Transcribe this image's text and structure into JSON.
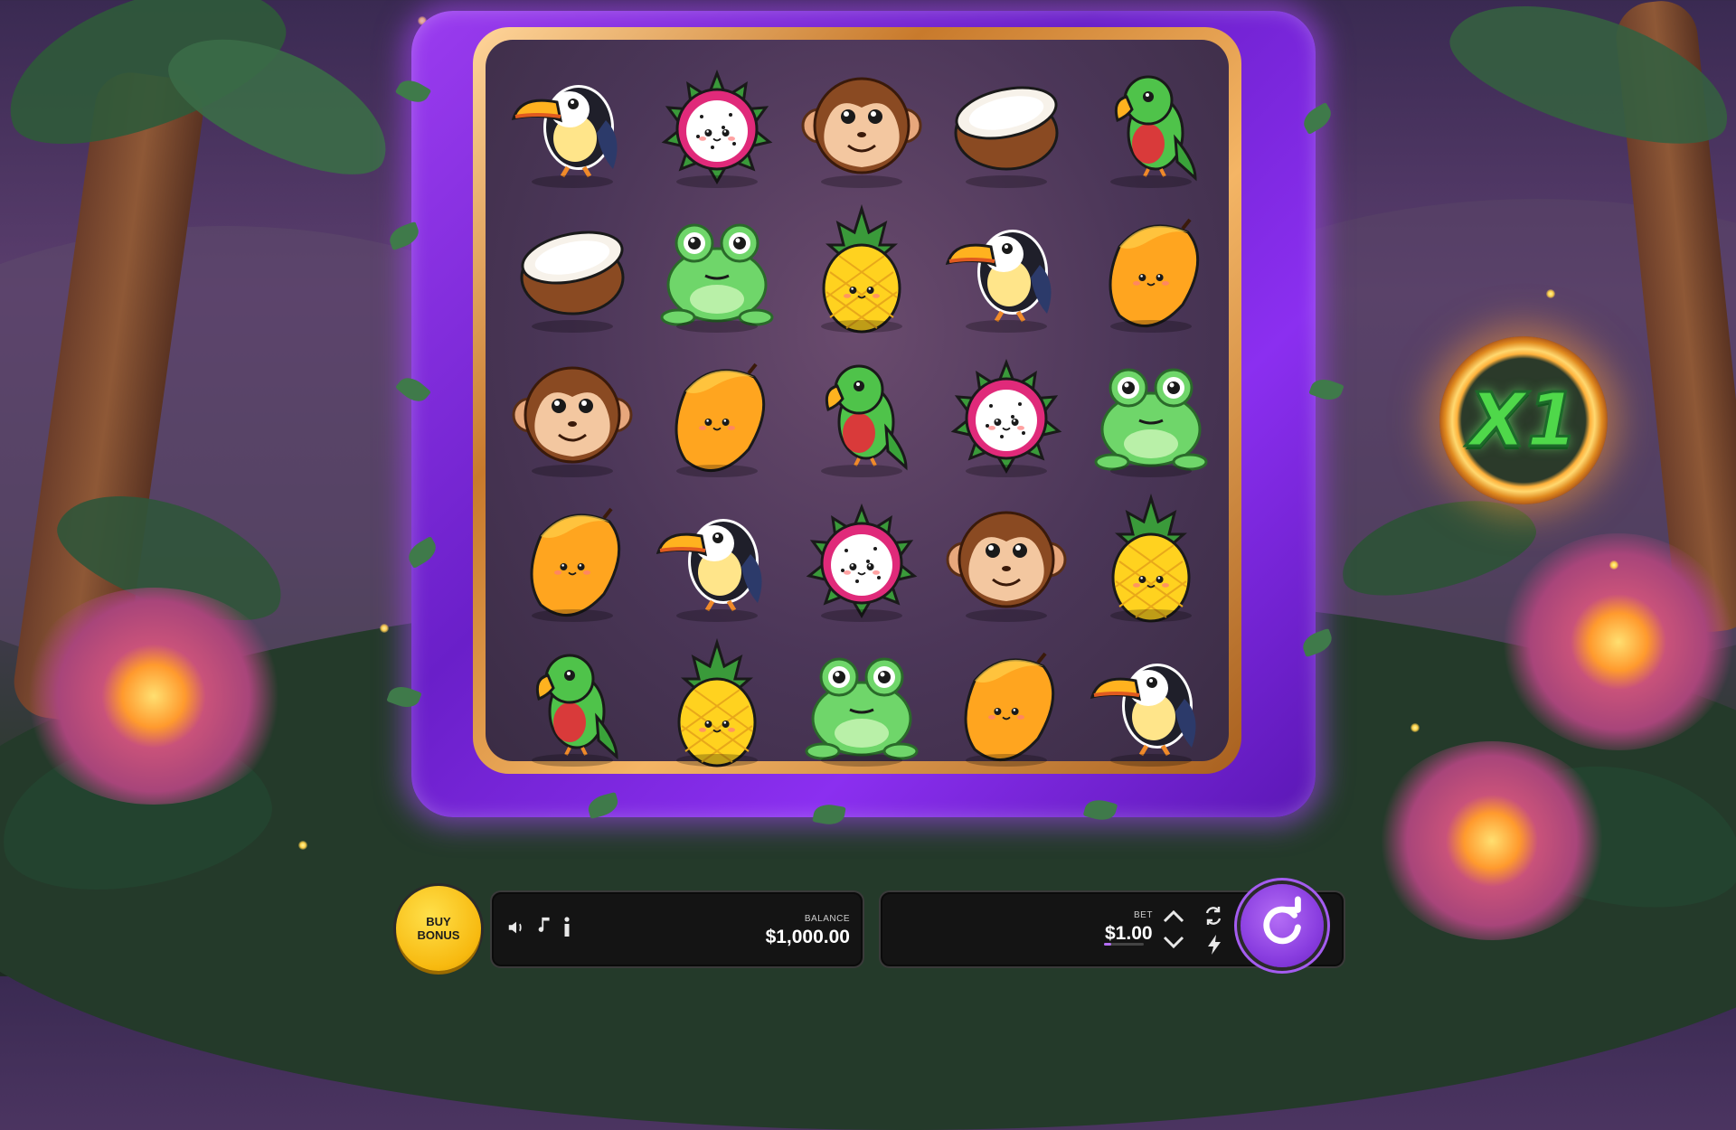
{
  "game": {
    "multiplier": "X1",
    "grid_rows": 5,
    "grid_cols": 5,
    "symbols": [
      [
        "toucan",
        "dragonfruit",
        "monkey",
        "coconut",
        "parrot"
      ],
      [
        "coconut",
        "frog",
        "pineapple",
        "toucan",
        "mango"
      ],
      [
        "monkey",
        "mango",
        "parrot",
        "dragonfruit",
        "frog"
      ],
      [
        "mango",
        "toucan",
        "dragonfruit",
        "monkey",
        "pineapple"
      ],
      [
        "parrot",
        "pineapple",
        "frog",
        "mango",
        "toucan"
      ]
    ]
  },
  "controls": {
    "buy_bonus_line1": "BUY",
    "buy_bonus_line2": "BONUS",
    "balance_label": "BALANCE",
    "balance_value": "$1,000.00",
    "bet_label": "BET",
    "bet_value": "$1.00",
    "sound_icon": "speaker-icon",
    "music_icon": "music-note-icon",
    "info_icon": "info-icon",
    "autoplay_icon": "autoplay-icon",
    "turbo_icon": "lightning-icon",
    "spin_icon": "spin-arrow-icon"
  },
  "colors": {
    "frame_purple": "#8b2ff0",
    "frame_gold": "#e8a04a",
    "spin_purple": "#8a3ee0",
    "buy_yellow": "#f7b90f",
    "multiplier_green": "#4fd84a"
  }
}
